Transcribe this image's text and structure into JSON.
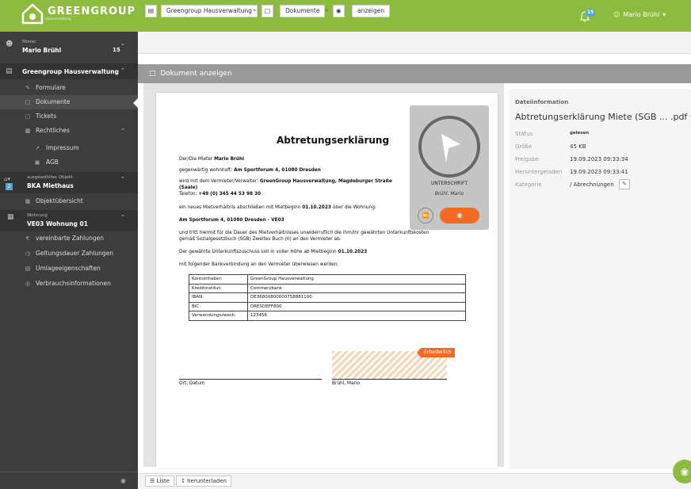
{
  "brand": {
    "name": "GREENGROUP",
    "tagline": "Hausverwaltung"
  },
  "header": {
    "notification_count": "15",
    "user": "Mario Brühl",
    "user_caret": "▾"
  },
  "sidebar": {
    "tenant_label": "Mieter",
    "tenant_name": "Mario Brühl",
    "tenant_count": "15",
    "org_name": "Greengroup Hausverwaltung",
    "items": [
      {
        "label": "Formulare",
        "icon": "form-icon"
      },
      {
        "label": "Dokumente",
        "icon": "document-icon"
      },
      {
        "label": "Tickets",
        "icon": "ticket-icon"
      },
      {
        "label": "Rechtliches",
        "icon": "legal-icon"
      },
      {
        "label": "Impressum",
        "icon": "link-icon"
      },
      {
        "label": "AGB",
        "icon": "page-icon"
      }
    ],
    "object_label": "ausgewähltes Objekt",
    "object_count": "2",
    "object_name": "BKA Miethaus",
    "object_overview": "Objektübersicht",
    "unit_label": "Wohnung",
    "unit_name": "VE03 Wohnung 01",
    "unit_items": [
      {
        "label": "vereinbarte Zahlungen",
        "icon": "euro-icon"
      },
      {
        "label": "Geltungsdauer Zahlungen",
        "icon": "clock-icon"
      },
      {
        "label": "Umlageeigenschaften",
        "icon": "table-icon"
      },
      {
        "label": "Verbrauchsinformationen",
        "icon": "gauge-icon"
      }
    ]
  },
  "breadcrumb": {
    "items": [
      "Greengroup Hausverwaltung",
      "Dokumente",
      "anzeigen"
    ],
    "separator": "»"
  },
  "panel": {
    "title": "Dokument anzeigen"
  },
  "document": {
    "title": "Abtretungserklärung",
    "line1_prefix": "Der/Die Mieter ",
    "line1_name": "Mario Brühl",
    "line2_prefix": "gegenwärtig wohnhaft: ",
    "line2_addr": "Am Sportforum 4, 01080 Dresden",
    "line3_prefix": "wird mit dem Vermieter/Verwalter: ",
    "line3_name": "GreenGroup Hausverwaltung, Magdeburger Straße",
    "line3b": "(Saale)",
    "line3c_prefix": "Telefon: ",
    "line3c_phone": "+49 (0) 345 44 53 98 30",
    "line4_prefix": "ein neues Mietverhältnis abschließen mit Mietbeginn ",
    "line4_date": "01.10.2023",
    "line4_suffix": "  über die Wohnung:",
    "line5": "Am Sportforum 4, 01080 Dresden - VE03",
    "line6": "und tritt hiermit für die Dauer des Mietverhältnisses unwiderruflich die ihm/ihr gewährten Unterkunftskosten",
    "line6b": "gemäß Sozialgesetzbuch (SGB) Zweites Buch (II) an den Vermieter ab.",
    "line7_prefix": "Der gewährte Unterkunftszuschuss soll in voller Höhe ab Mietbeginn ",
    "line7_date": "01.10.2023",
    "line8": "mit folgender Bankverbindung an den Vermieter überwiesen werden:",
    "bank": [
      [
        "Kontoinhaber:",
        "GreenGroup Hausverwaltung"
      ],
      [
        "Kreditinstitut:",
        "Commerzbank"
      ],
      [
        "IBAN:",
        "DE36800800000758881100"
      ],
      [
        "BIC:",
        "DRESDEFF800"
      ],
      [
        "Verwendungszweck:",
        "123456"
      ]
    ],
    "sig_left": "Ort, Datum",
    "sig_right": "Brühl, Mario"
  },
  "signature_card": {
    "label": "UNTERSCHRIFT",
    "signer": "Brühl, Mario",
    "required_badge": "Erforderlich"
  },
  "fileinfo": {
    "heading": "Dateiinformation",
    "title": "Abtretungserklärung Miete (SGB ... .pdf",
    "rows": [
      {
        "label": "Status",
        "value": "gelesen"
      },
      {
        "label": "Größe",
        "value": "45 KB"
      },
      {
        "label": "Freigabe",
        "value": "19.09.2023 09:33:34"
      },
      {
        "label": "Heruntergeladen",
        "value": "19.09.2023 09:33:41"
      },
      {
        "label": "Kategorie",
        "value": "/ Abrechnungen"
      }
    ]
  },
  "bottombar": {
    "list_label": "Liste",
    "download_label": "herunterladen"
  },
  "colors": {
    "brand": "#8dbb3e",
    "sidebar": "#3d3d3d",
    "accent": "#f36a22",
    "badge": "#4aa8de"
  }
}
